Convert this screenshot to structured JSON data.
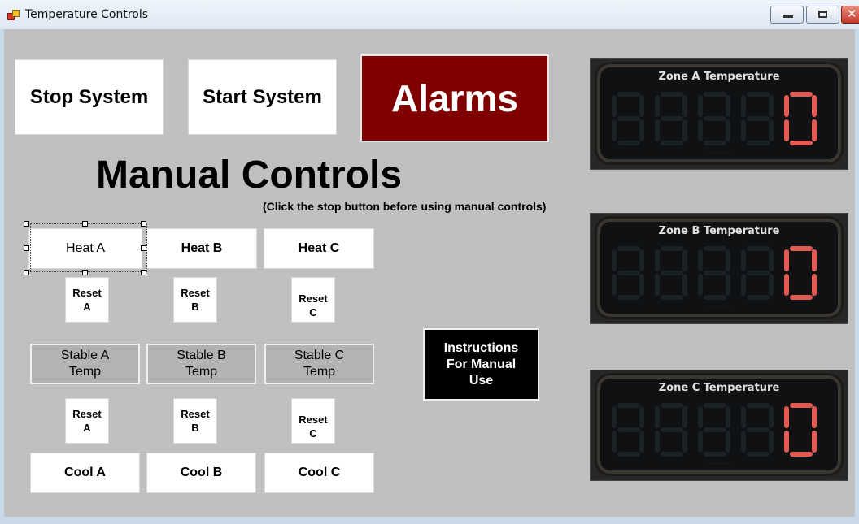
{
  "window": {
    "title": "Temperature Controls",
    "close_glyph": "✕"
  },
  "toolbar": {
    "stop_label": "Stop System",
    "start_label": "Start System",
    "alarms_label": "Alarms",
    "alarms_color": "#800000"
  },
  "manual": {
    "heading": "Manual Controls",
    "hint": "(Click the stop button before using manual controls)",
    "heat": [
      "Heat A",
      "Heat B",
      "Heat C"
    ],
    "reset_top": [
      [
        "Reset",
        "A"
      ],
      [
        "Reset",
        "B"
      ],
      [
        "Reset",
        "C"
      ]
    ],
    "stable": [
      [
        "Stable A",
        "Temp"
      ],
      [
        "Stable B",
        "Temp"
      ],
      [
        "Stable C",
        "Temp"
      ]
    ],
    "reset_bottom": [
      [
        "Reset",
        "A"
      ],
      [
        "Reset",
        "B"
      ],
      [
        "Reset",
        "C"
      ]
    ],
    "cool": [
      "Cool A",
      "Cool B",
      "Cool C"
    ]
  },
  "instructions": {
    "lines": [
      "Instructions",
      "For Manual",
      "Use"
    ]
  },
  "gauges": [
    {
      "title": "Zone A Temperature",
      "value": "0"
    },
    {
      "title": "Zone B Temperature",
      "value": "0"
    },
    {
      "title": "Zone C Temperature",
      "value": "0"
    }
  ],
  "colors": {
    "digit_on": "#e35a52",
    "digit_off": "#1b2226",
    "client_bg": "#c0c0c0"
  }
}
